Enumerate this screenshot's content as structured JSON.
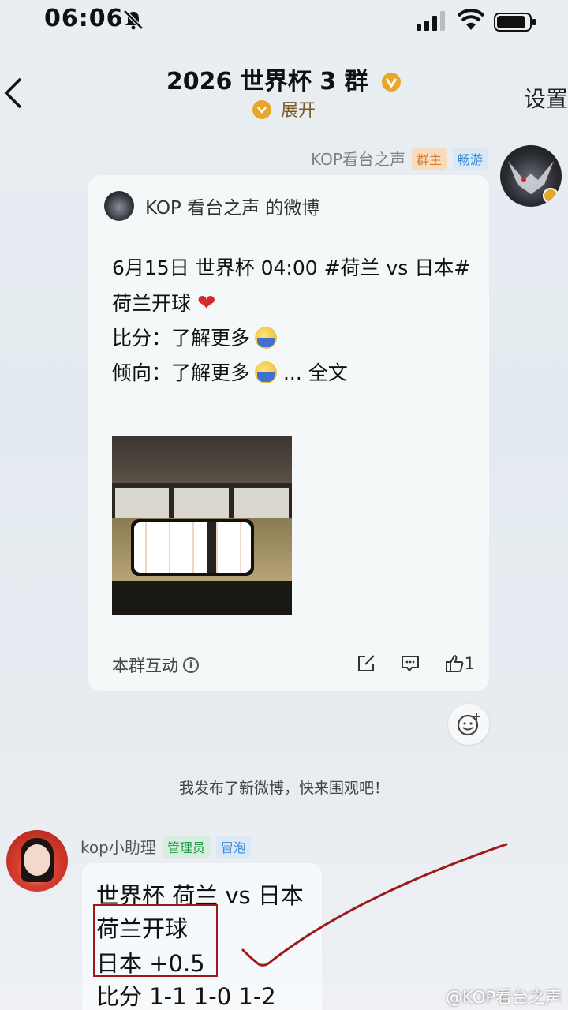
{
  "status_bar": {
    "time": "06:06"
  },
  "nav": {
    "title": "2026 世界杯 3 群",
    "expand_label": "展开",
    "settings_label": "设置"
  },
  "message1": {
    "sender_name": "KOP看台之声",
    "tag_owner": "群主",
    "tag_level": "畅游",
    "card": {
      "source": "KOP 看台之声  的微博",
      "line1": "6月15日 世界杯 04:00 #荷兰 vs 日本#",
      "line2": "荷兰开球",
      "line2_emoji": "❤",
      "line3": "比分：了解更多",
      "line4": "倾向：了解更多",
      "line4_suffix": " ... 全文",
      "footer_label": "本群互动",
      "like_count": "1"
    }
  },
  "system_message": "我发布了新微博，快来围观吧！",
  "message2": {
    "sender_name": "kop小助理",
    "tag_admin": "管理员",
    "tag_level": "冒泡",
    "line1": "世界杯 荷兰 vs 日本",
    "line2": "荷兰开球",
    "line3": "日本 +0.5",
    "line4": "比分 1-1 1-0 1-2"
  },
  "watermark": "@KOP看台之声",
  "colors": {
    "accent_gold": "#e8a62a",
    "owner_tag": "#d9782b",
    "admin_tag": "#1f9a4a",
    "annotation_red": "#9c1a1a"
  }
}
